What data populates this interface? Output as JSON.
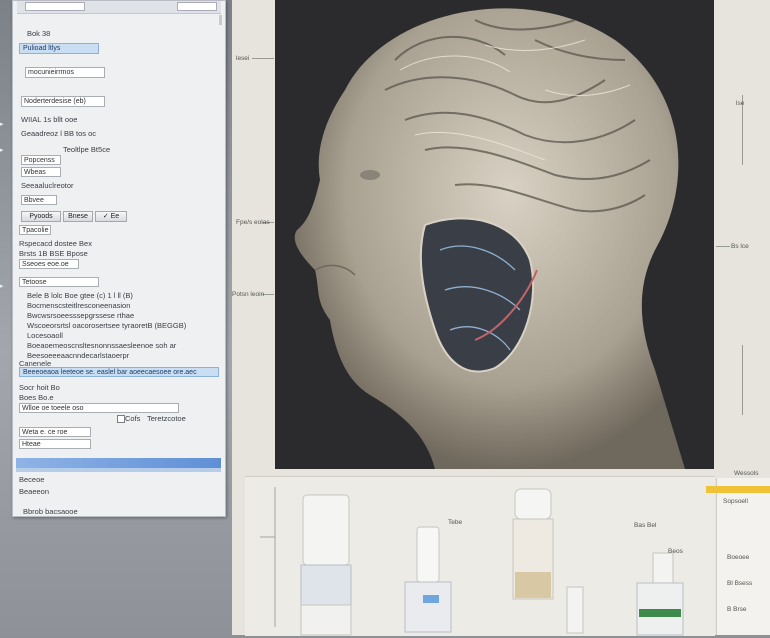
{
  "panel": {
    "top_field_left": "",
    "top_field_right": "",
    "rows": [
      {
        "text": "Bok 38"
      },
      {
        "text": "Pulioad ltlys"
      },
      {
        "text": "mocunieirrmos"
      },
      {
        "text": "Noderterdesise (eb)"
      },
      {
        "text": "WIIAL 1s bllt ooe"
      },
      {
        "text": "Geaadreoz  l BB tos oc"
      },
      {
        "text": "Teoltlpe  Bt5ce"
      },
      {
        "text": "Popcenss"
      },
      {
        "text": "Wbeas"
      },
      {
        "text": "Seeaaluclreotor"
      },
      {
        "text": "Bbvee"
      },
      {
        "text": "Tpacolie"
      },
      {
        "text": "Tetoose"
      },
      {
        "text": "Rspecacd dostee Bex"
      },
      {
        "text": "Brsts 1B BSE  Bpose"
      },
      {
        "text": "Sseoes eoe.oe"
      },
      {
        "text": "Bele  B lolc  Boe  gtee (c)  1 l ll (B)"
      },
      {
        "text": "Bocmenscsteitlresconeenasion"
      },
      {
        "text": "Bwcwsrsoeesssepgrssese rthae"
      },
      {
        "text": "Wscoeorsrtsl oacorosertsee tyraoretB (BEGGB)"
      },
      {
        "text": "Locesoaoll"
      },
      {
        "text": "Boeaoemeoscnsltesnonnssaesleenoe soh ar"
      },
      {
        "text": "Beesoeeeaacnndecarlstaoerpr"
      },
      {
        "text": "Canenele"
      },
      {
        "text": "Beeeoeaoa leeteoe se. easlel bar aoeecaesoee ore.aec"
      },
      {
        "text": "Socr hoit Bo"
      },
      {
        "text": "Boes Bo.e"
      },
      {
        "text": "Wlloe  oe toeele oso"
      },
      {
        "text": "  Cofs"
      },
      {
        "text": "  Teretzcotoe"
      },
      {
        "text": "Weta  e.  ce roe"
      },
      {
        "text": "Hteae"
      },
      {
        "text": "Beceoe"
      },
      {
        "text": "Beaeeon"
      },
      {
        "text": "Bbrob bacsaooe"
      }
    ],
    "buttons": {
      "b1": "Pyoods",
      "b2": "Bnese",
      "b3": "✓ Ee"
    },
    "footer": "Bbrob bacsaooe"
  },
  "canvas": {
    "labels": [
      {
        "text": "lesei"
      },
      {
        "text": "Fpe/s eolas"
      },
      {
        "text": "Potsn leoin"
      },
      {
        "text": "lse"
      },
      {
        "text": "Bs lce"
      },
      {
        "text": "Wessols"
      },
      {
        "text": "Tebe"
      },
      {
        "text": "Bas Bel"
      },
      {
        "text": "Beos"
      }
    ],
    "right_labels": [
      {
        "text": "Sopsoell"
      },
      {
        "text": "Boeoee"
      },
      {
        "text": "Bl Bsess"
      },
      {
        "text": "B Brse"
      }
    ]
  },
  "colors": {
    "panel_bg": "#eef0f2",
    "viewport_bg": "#2b2b2d",
    "selection": "#5e8fd6",
    "accent_yellow": "#f0c238"
  }
}
